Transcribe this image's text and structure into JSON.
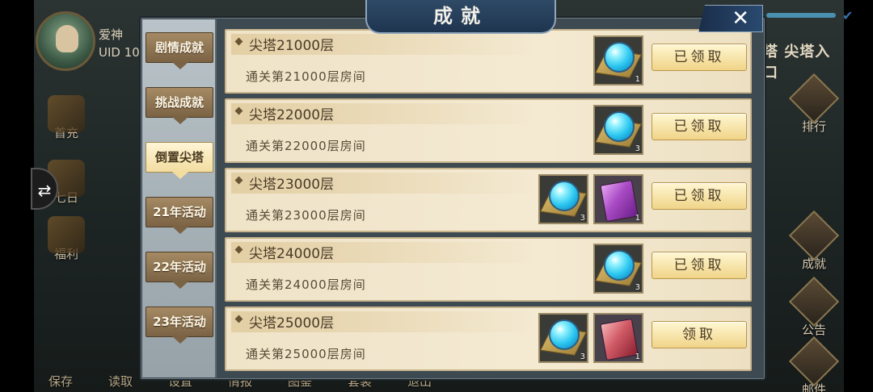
{
  "player": {
    "name": "爱神",
    "uid": "UID 10"
  },
  "hud_left": [
    {
      "label": "首充",
      "icon": "gift-icon"
    },
    {
      "label": "七日",
      "icon": "calendar-icon"
    },
    {
      "label": "福利",
      "icon": "welfare-icon"
    }
  ],
  "hud_right": [
    {
      "label": "排行",
      "icon": "ranking-icon"
    },
    {
      "label": "成就",
      "icon": "achievement-icon"
    },
    {
      "label": "公告",
      "icon": "notice-icon"
    },
    {
      "label": "邮件",
      "icon": "mail-icon"
    }
  ],
  "tower_entry": "塔 尖塔入口",
  "bottom_menu": [
    "保存",
    "读取",
    "设置",
    "情报",
    "图鉴",
    "套装",
    "退出"
  ],
  "panel": {
    "title": "成就",
    "close_icon": "close-icon"
  },
  "tabs": [
    {
      "label": "剧情成就",
      "active": false
    },
    {
      "label": "挑战成就",
      "active": false
    },
    {
      "label": "倒置尖塔",
      "active": true
    },
    {
      "label": "21年活动",
      "active": false
    },
    {
      "label": "22年活动",
      "active": false
    },
    {
      "label": "23年活动",
      "active": false
    }
  ],
  "achievements": [
    {
      "title": "尖塔21000层",
      "desc": "通关第21000层房间",
      "rewards": [
        {
          "type": "orb",
          "qty": "1"
        }
      ],
      "button": "已领取"
    },
    {
      "title": "尖塔22000层",
      "desc": "通关第22000层房间",
      "rewards": [
        {
          "type": "orb",
          "qty": "3"
        }
      ],
      "button": "已领取"
    },
    {
      "title": "尖塔23000层",
      "desc": "通关第23000层房间",
      "rewards": [
        {
          "type": "orb",
          "qty": "3"
        },
        {
          "type": "purple-book",
          "qty": "1"
        }
      ],
      "button": "已领取"
    },
    {
      "title": "尖塔24000层",
      "desc": "通关第24000层房间",
      "rewards": [
        {
          "type": "orb",
          "qty": "3"
        }
      ],
      "button": "已领取"
    },
    {
      "title": "尖塔25000层",
      "desc": "通关第25000层房间",
      "rewards": [
        {
          "type": "orb",
          "qty": "3"
        },
        {
          "type": "red-book",
          "qty": "1"
        }
      ],
      "button": "领取"
    }
  ],
  "colors": {
    "panel_bg": "#3e4a52",
    "row_bg": "#f4ead2",
    "button_gold": "#f0d488",
    "orb_blue": "#2cc7f0"
  }
}
